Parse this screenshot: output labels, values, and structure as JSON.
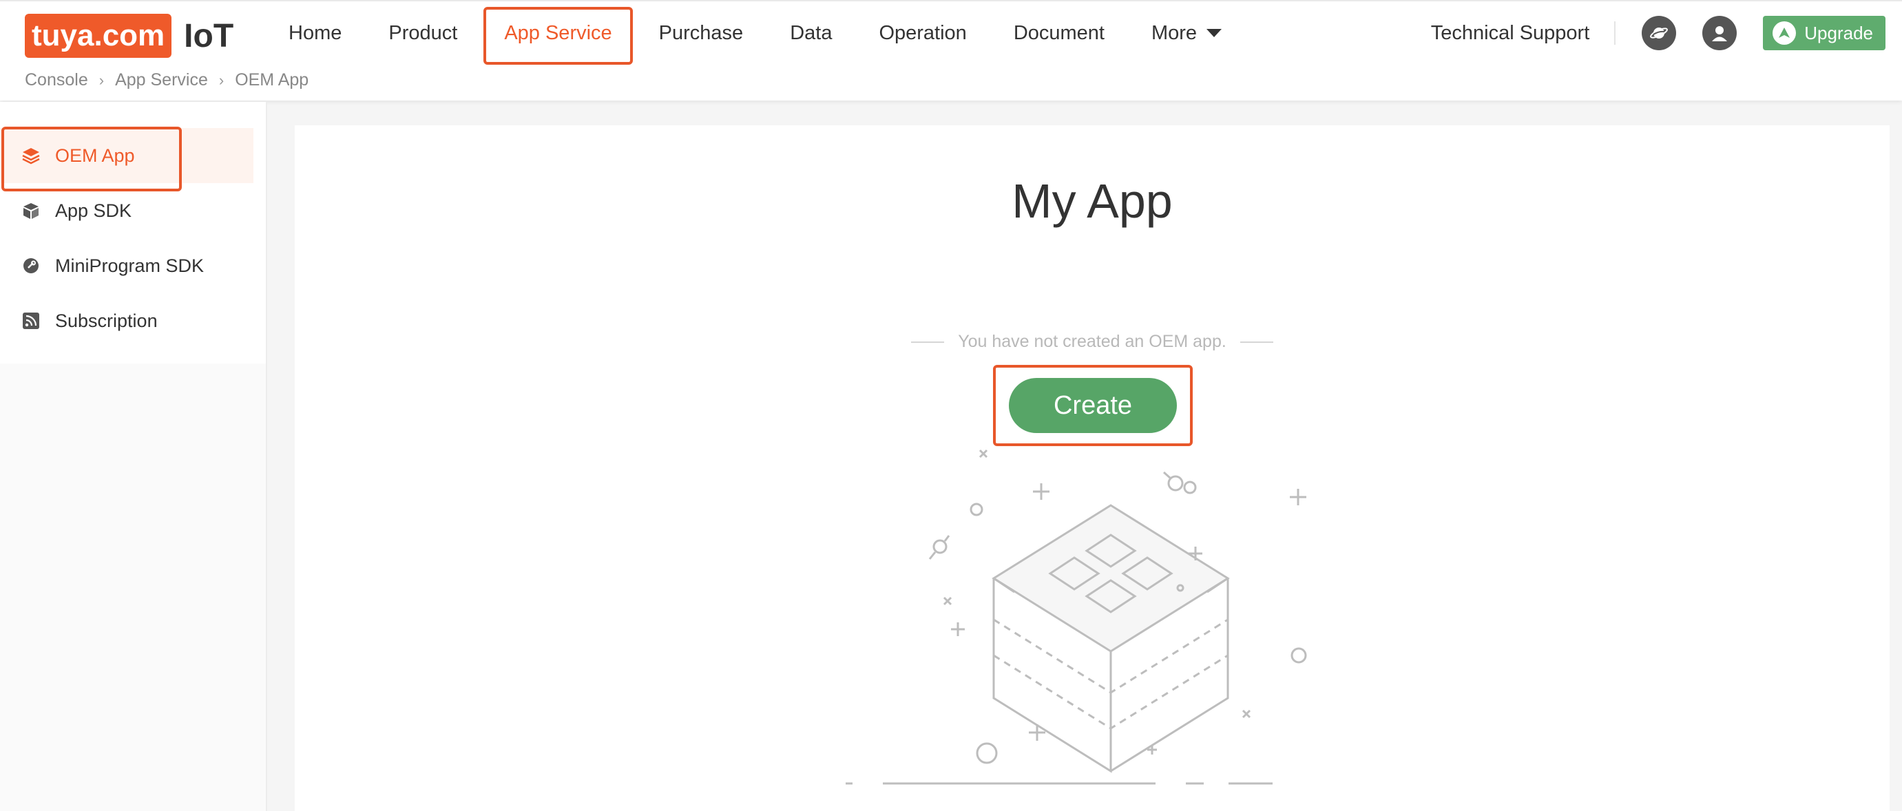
{
  "brand": {
    "logo_text": "tuya.com",
    "product": "IoT",
    "accent_color": "#ef5a2a"
  },
  "nav": {
    "items": [
      {
        "label": "Home"
      },
      {
        "label": "Product"
      },
      {
        "label": "App Service",
        "active": true
      },
      {
        "label": "Purchase"
      },
      {
        "label": "Data"
      },
      {
        "label": "Operation"
      },
      {
        "label": "Document"
      },
      {
        "label": "More"
      }
    ]
  },
  "header_right": {
    "tech_support": "Technical Support",
    "icons": [
      "planet-icon",
      "user-icon"
    ],
    "upgrade_label": "Upgrade",
    "upgrade_color": "#5fac6e"
  },
  "breadcrumb": [
    "Console",
    "App Service",
    "OEM App"
  ],
  "sidebar": {
    "items": [
      {
        "label": "OEM App",
        "icon": "layers-icon",
        "active": true
      },
      {
        "label": "App SDK",
        "icon": "cube-icon"
      },
      {
        "label": "MiniProgram SDK",
        "icon": "link-icon"
      },
      {
        "label": "Subscription",
        "icon": "rss-icon"
      }
    ]
  },
  "main": {
    "title": "My App",
    "empty_message": "You have not created an OEM app.",
    "create_label": "Create",
    "create_color": "#57a567"
  }
}
